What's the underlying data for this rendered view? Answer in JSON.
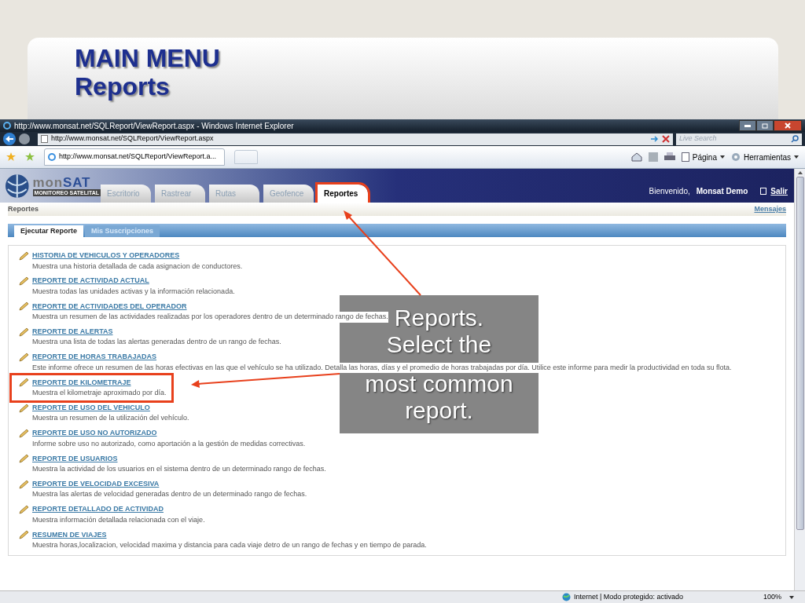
{
  "slide": {
    "title_lines": [
      "MAIN MENU",
      "Reports"
    ]
  },
  "browser": {
    "title": "http://www.monsat.net/SQLReport/ViewReport.aspx - Windows Internet Explorer",
    "address": "http://www.monsat.net/SQLReport/ViewReport.aspx",
    "search_placeholder": "Live Search",
    "tab_title": "http://www.monsat.net/SQLReport/ViewReport.a...",
    "commands": [
      "Página",
      "Herramientas"
    ],
    "status": "Internet | Modo protegido: activado",
    "zoom": "100%"
  },
  "app": {
    "logo": {
      "part_a": "mon",
      "part_b": "SAT",
      "tagline": "MONITOREO SATELITAL"
    },
    "nav_tabs": [
      {
        "label": "Escritorio",
        "selected": false,
        "highlighted": false
      },
      {
        "label": "Rastrear",
        "selected": false,
        "highlighted": false
      },
      {
        "label": "Rutas",
        "selected": false,
        "highlighted": false
      },
      {
        "label": "Geofence",
        "selected": false,
        "highlighted": false
      },
      {
        "label": "Reportes",
        "selected": true,
        "highlighted": true
      }
    ],
    "welcome": "Bienvenido,",
    "user": "Monsat Demo",
    "logout": "Salir",
    "breadcrumb": "Reportes",
    "messages": "Mensajes",
    "sub_tabs": [
      {
        "label": "Ejecutar Reporte",
        "selected": true
      },
      {
        "label": "Mis Suscripciones",
        "selected": false
      }
    ],
    "reports": [
      {
        "title": "HISTORIA DE VEHICULOS Y OPERADORES",
        "description": "Muestra una historia detallada de cada asignacion de conductores.",
        "highlighted": false
      },
      {
        "title": "REPORTE DE ACTIVIDAD ACTUAL",
        "description": "Muestra todas las unidades activas y la información relacionada.",
        "highlighted": false
      },
      {
        "title": "REPORTE DE ACTIVIDADES DEL OPERADOR",
        "description": "Muestra un resumen de las actividades realizadas por los operadores dentro de un determinado rango de fechas.",
        "highlighted": false
      },
      {
        "title": "REPORTE DE ALERTAS",
        "description": "Muestra una lista de todas las alertas generadas dentro de un rango de fechas.",
        "highlighted": false
      },
      {
        "title": "REPORTE DE HORAS TRABAJADAS",
        "description": "Este informe ofrece un resumen de las horas efectivas en las que el vehículo se ha utilizado. Detalla las horas, días y el promedio de horas trabajadas por día. Utilice este informe para medir la productividad en toda su flota.",
        "highlighted": false
      },
      {
        "title": "REPORTE DE KILOMETRAJE",
        "description": "Muestra el kilometraje aproximado por día.",
        "highlighted": true
      },
      {
        "title": "REPORTE DE USO DEL VEHICULO",
        "description": "Muestra un resumen de la utilización del vehículo.",
        "highlighted": false
      },
      {
        "title": "REPORTE DE USO NO AUTORIZADO",
        "description": "Informe sobre uso no autorizado, como aportación a la gestión de medidas correctivas.",
        "highlighted": false
      },
      {
        "title": "REPORTE DE USUARIOS",
        "description": "Muestra la actividad de los usuarios en el sistema dentro de un determinado rango de fechas.",
        "highlighted": false
      },
      {
        "title": "REPORTE DE VELOCIDAD EXCESIVA",
        "description": "Muestra las alertas de velocidad generadas dentro de un determinado rango de fechas.",
        "highlighted": false
      },
      {
        "title": "REPORTE DETALLADO DE ACTIVIDAD",
        "description": "Muestra información detallada relacionada con el viaje.",
        "highlighted": false
      },
      {
        "title": "RESUMEN DE VIAJES",
        "description": "Muestra horas,localizacion, velocidad maxima y distancia para cada viaje detro de un rango de fechas y en tiempo de parada.",
        "highlighted": false
      }
    ]
  },
  "callout": {
    "lines": [
      "Reports.",
      "Select the",
      "most common",
      "report."
    ]
  }
}
